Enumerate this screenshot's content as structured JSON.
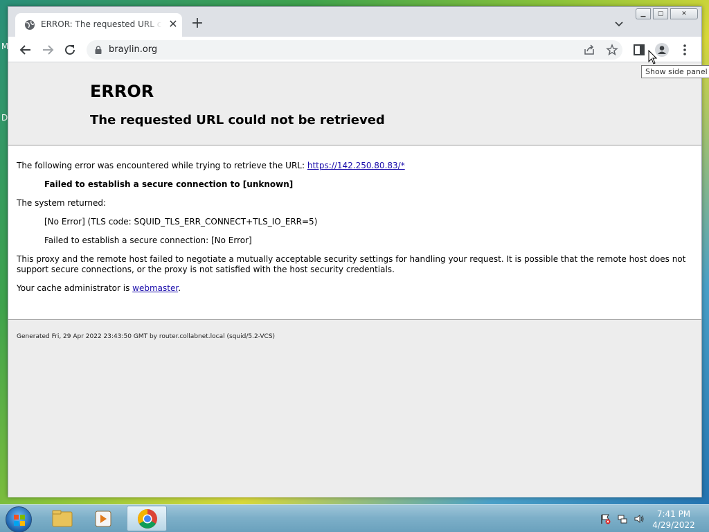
{
  "desktop": {
    "label_1": "M",
    "label_2": "D"
  },
  "browser": {
    "tab_title": "ERROR: The requested URL could not be retrieved",
    "url": "braylin.org",
    "tooltip": "Show side panel"
  },
  "page": {
    "heading": "ERROR",
    "subheading": "The requested URL could not be retrieved",
    "line1_prefix": "The following error was encountered while trying to retrieve the URL: ",
    "line1_link": "https://142.250.80.83/*",
    "failed_title": "Failed to establish a secure connection to [unknown]",
    "system_returned": "The system returned:",
    "tls_code": "[No Error] (TLS code: SQUID_TLS_ERR_CONNECT+TLS_IO_ERR=5)",
    "failed_detail": "Failed to establish a secure connection: [No Error]",
    "explanation": "This proxy and the remote host failed to negotiate a mutually acceptable security settings for handling your request. It is possible that the remote host does not support secure connections, or the proxy is not satisfied with the host security credentials.",
    "admin_prefix": "Your cache administrator is ",
    "admin_link": "webmaster",
    "admin_suffix": ".",
    "footer": "Generated Fri, 29 Apr 2022 23:43:50 GMT by router.collabnet.local (squid/5.2-VCS)"
  },
  "taskbar": {
    "time": "7:41 PM",
    "date": "4/29/2022"
  }
}
